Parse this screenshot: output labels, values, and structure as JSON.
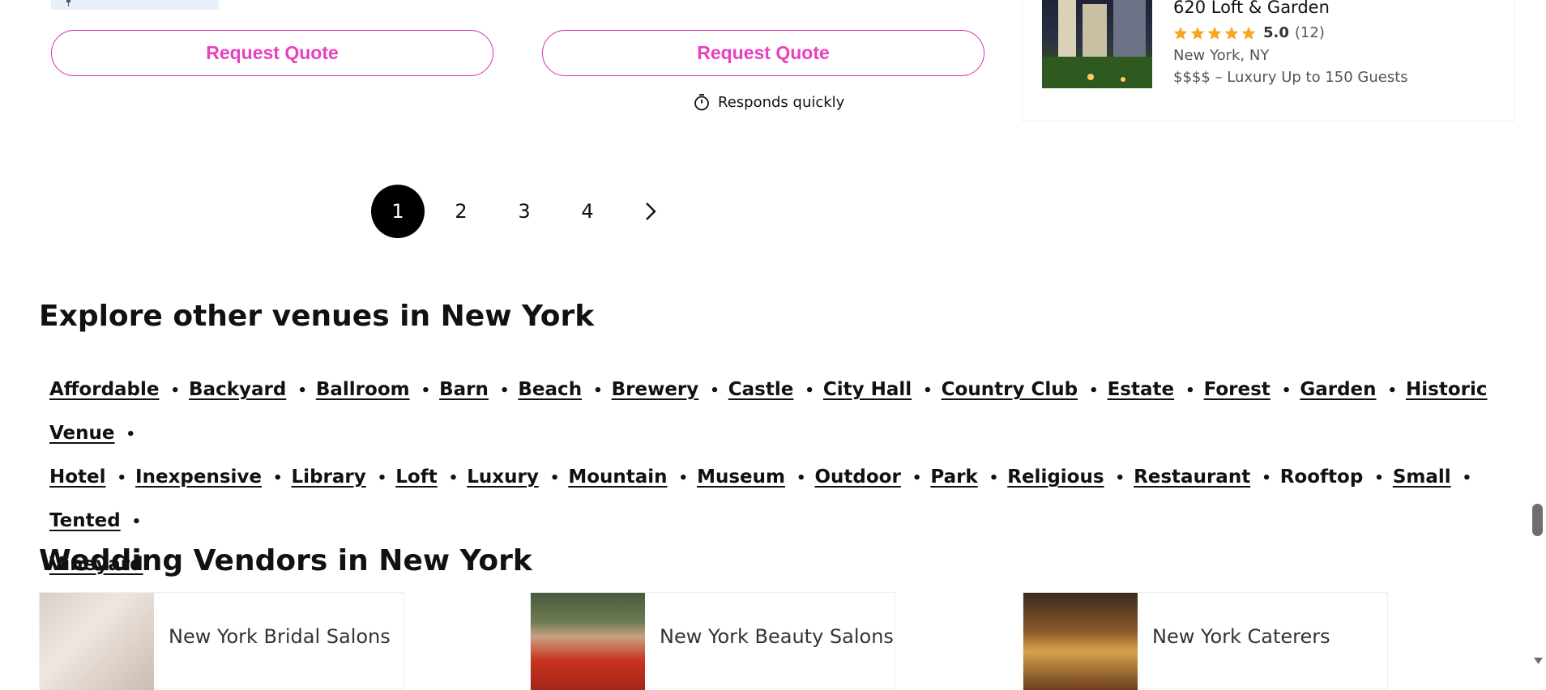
{
  "listing": {
    "request_quote_1": "Request Quote",
    "request_quote_2": "Request Quote",
    "responds_text": "Responds quickly"
  },
  "side_venue": {
    "name": "620 Loft & Garden",
    "rating": "5.0",
    "reviews": "(12)",
    "stars": 5,
    "location": "New York, NY",
    "price": "$$$$ – Luxury",
    "guests": "Up to 150 Guests"
  },
  "pagination": {
    "pages": [
      "1",
      "2",
      "3",
      "4"
    ],
    "current": "1"
  },
  "explore": {
    "title": "Explore other venues in New York",
    "links": [
      {
        "label": "Affordable",
        "linked": true
      },
      {
        "label": "Backyard",
        "linked": true
      },
      {
        "label": "Ballroom",
        "linked": true
      },
      {
        "label": "Barn",
        "linked": true
      },
      {
        "label": "Beach",
        "linked": true
      },
      {
        "label": "Brewery",
        "linked": true
      },
      {
        "label": "Castle",
        "linked": true
      },
      {
        "label": "City Hall",
        "linked": true
      },
      {
        "label": "Country Club",
        "linked": true
      },
      {
        "label": "Estate",
        "linked": true
      },
      {
        "label": "Forest",
        "linked": true
      },
      {
        "label": "Garden",
        "linked": true
      },
      {
        "label": "Historic Venue",
        "linked": true
      },
      {
        "label": "Hotel",
        "linked": true
      },
      {
        "label": "Inexpensive",
        "linked": true
      },
      {
        "label": "Library",
        "linked": true
      },
      {
        "label": "Loft",
        "linked": true
      },
      {
        "label": "Luxury",
        "linked": true
      },
      {
        "label": "Mountain",
        "linked": true
      },
      {
        "label": "Museum",
        "linked": true
      },
      {
        "label": "Outdoor",
        "linked": true
      },
      {
        "label": "Park",
        "linked": true
      },
      {
        "label": "Religious",
        "linked": true
      },
      {
        "label": "Restaurant",
        "linked": true
      },
      {
        "label": "Rooftop",
        "linked": false
      },
      {
        "label": "Small",
        "linked": true
      },
      {
        "label": "Tented",
        "linked": true
      },
      {
        "label": "Vineyard",
        "linked": true
      }
    ]
  },
  "vendors": {
    "title": "Wedding Vendors in New York",
    "items": [
      {
        "label": "New York Bridal Salons"
      },
      {
        "label": "New York Beauty Salons"
      },
      {
        "label": "New York Caterers"
      }
    ]
  },
  "colors": {
    "accent": "#e840be",
    "star": "#f5a623"
  }
}
